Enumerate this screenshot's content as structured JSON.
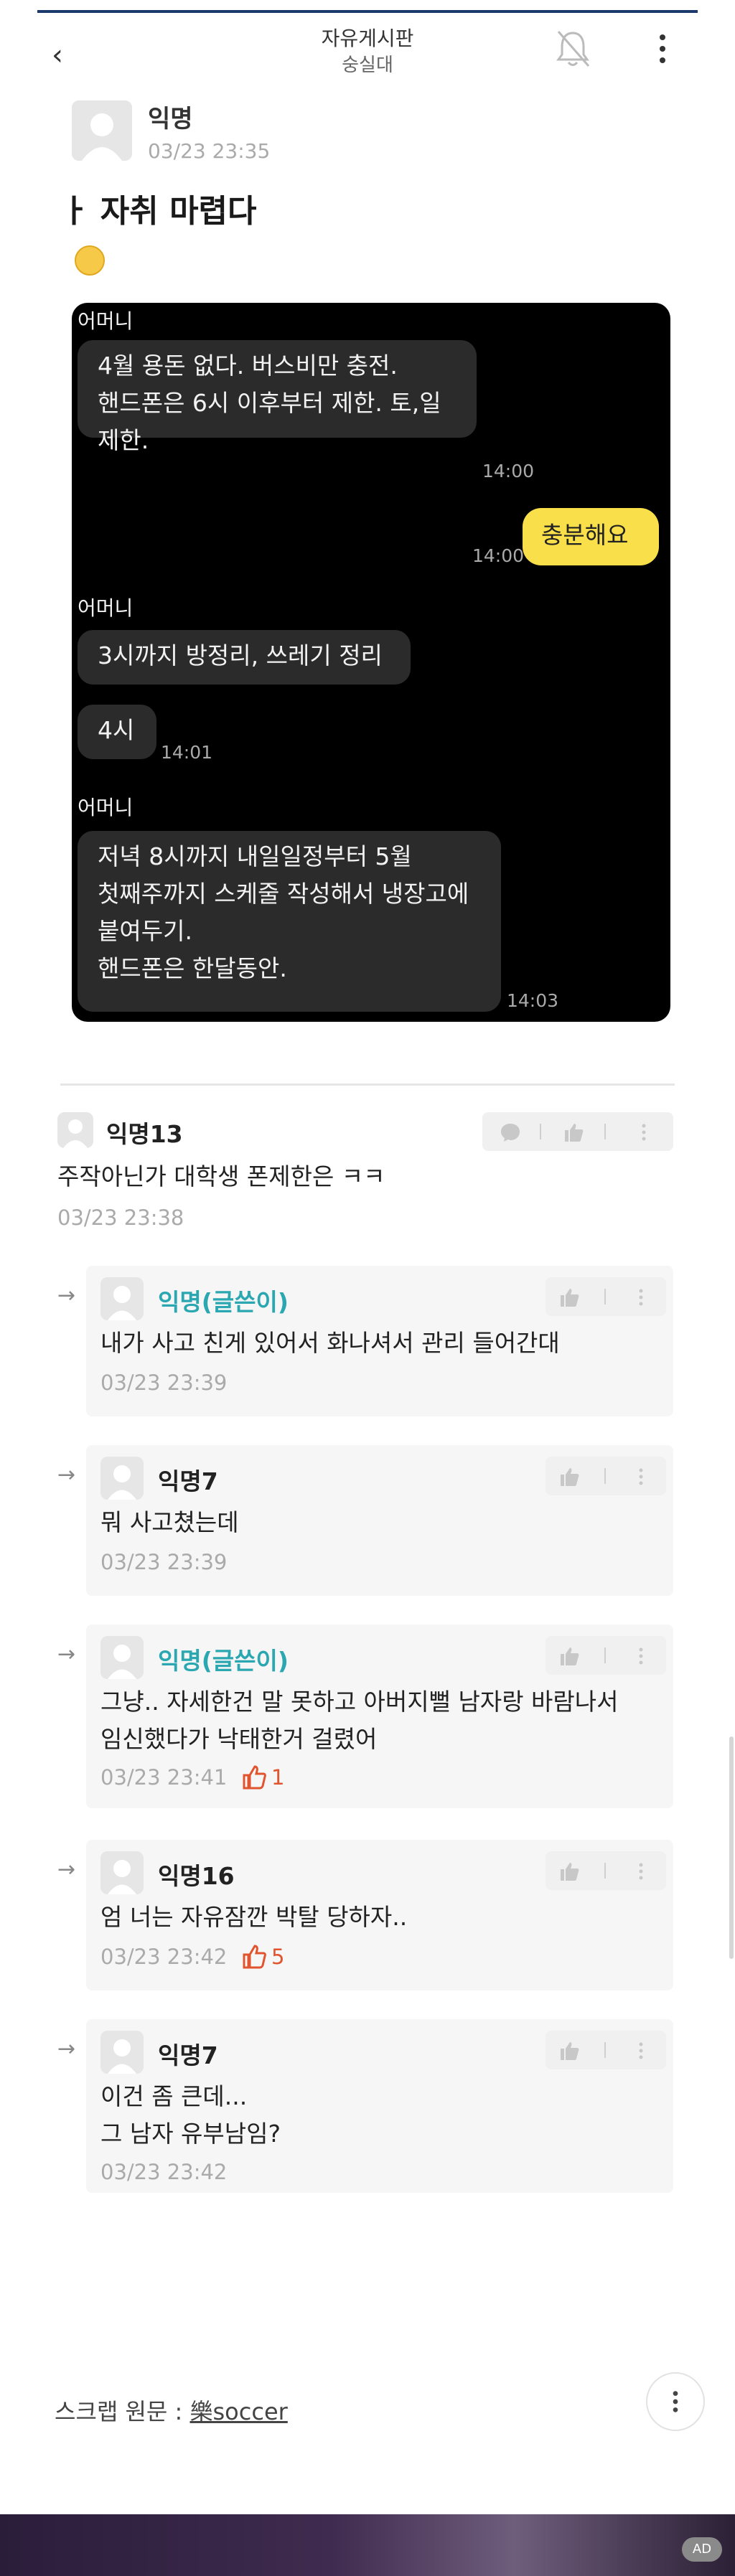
{
  "header": {
    "title": "자유게시판",
    "subtitle": "숭실대"
  },
  "post": {
    "author": "익명",
    "time": "03/23 23:35",
    "title": "ㅏ 자취 마렵다"
  },
  "chat": {
    "messages": [
      {
        "sender": "어머니",
        "lines": [
          "4월 용돈 없다. 버스비만 충전.",
          "핸드폰은 6시 이후부터 제한. 토,일",
          "제한."
        ],
        "time": "14:00"
      },
      {
        "me": true,
        "lines": [
          "충분해요"
        ],
        "time": "14:00"
      },
      {
        "sender": "어머니",
        "lines": [
          "3시까지 방정리, 쓰레기 정리"
        ]
      },
      {
        "lines": [
          "4시"
        ],
        "time": "14:01"
      },
      {
        "sender": "어머니",
        "lines": [
          "저녁 8시까지 내일일정부터 5월",
          "첫째주까지 스케줄 작성해서 냉장고에",
          "붙여두기.",
          "핸드폰은 한달동안."
        ],
        "time": "14:03"
      }
    ]
  },
  "comments": [
    {
      "author": "익명13",
      "text": "주작아닌가 대학생 폰제한은 ㅋㅋ",
      "time": "03/23 23:38"
    },
    {
      "author": "익명(글쓴이)",
      "text": "내가 사고 친게 있어서 화나셔서 관리 들어간대",
      "time": "03/23 23:39",
      "reply": true,
      "writer": true
    },
    {
      "author": "익명7",
      "text": "뭐 사고쳤는데",
      "time": "03/23 23:39",
      "reply": true
    },
    {
      "author": "익명(글쓴이)",
      "text1": "그냥.. 자세한건 말 못하고 아버지뻘 남자랑 바람나서",
      "text2": "임신했다가 낙태한거 걸렸어",
      "time": "03/23 23:41",
      "likes": "1",
      "reply": true,
      "writer": true
    },
    {
      "author": "익명16",
      "text": "엄 너는 자유잠깐 박탈 당하자..",
      "time": "03/23 23:42",
      "likes": "5",
      "reply": true
    },
    {
      "author": "익명7",
      "text1": "이건 좀 큰데...",
      "text2": "그 남자 유부남임?",
      "time": "03/23 23:42",
      "reply": true
    }
  ],
  "footer": {
    "scrap_label": "스크랩 원문 : ",
    "scrap_source": "樂soccer",
    "ad_badge": "AD"
  },
  "colors": {
    "accent_writer": "#2aa7b0",
    "like_red": "#e0542e",
    "kakao_yellow": "#f9e04a",
    "header_line": "#1a3a6b"
  }
}
